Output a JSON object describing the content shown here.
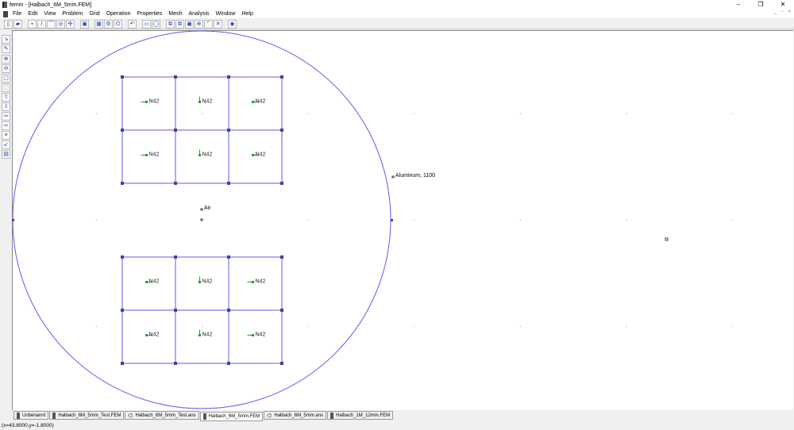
{
  "window": {
    "title": "femm - [Halbach_6M_5mm.FEM]",
    "controls": [
      "–",
      "❐",
      "✕"
    ],
    "mdi_controls": [
      "_",
      "▫",
      "×"
    ]
  },
  "menu": [
    "File",
    "Edit",
    "View",
    "Problem",
    "Grid",
    "Operation",
    "Properties",
    "Mesh",
    "Analysis",
    "Window",
    "Help"
  ],
  "toolbar": [
    {
      "icon": "new-file-icon",
      "g": "▯"
    },
    {
      "icon": "open-file-icon",
      "g": "▰"
    },
    {
      "sep": true
    },
    {
      "icon": "node-mode-icon",
      "g": "▪"
    },
    {
      "icon": "segment-mode-icon",
      "g": "/"
    },
    {
      "icon": "arc-mode-icon",
      "g": "⌒"
    },
    {
      "icon": "block-mode-icon",
      "g": "◎"
    },
    {
      "icon": "group-mode-icon",
      "g": "✣"
    },
    {
      "sep": true
    },
    {
      "icon": "properties-icon",
      "g": "▣"
    },
    {
      "sep": true
    },
    {
      "icon": "mesh-icon",
      "g": "▦"
    },
    {
      "icon": "run-analysis-icon",
      "g": "⚙"
    },
    {
      "icon": "view-results-icon",
      "g": "⌬"
    },
    {
      "sep": true
    },
    {
      "icon": "undo-icon",
      "g": "↶"
    },
    {
      "sep": true
    },
    {
      "icon": "select-box-icon",
      "g": "▭"
    },
    {
      "icon": "select-circle-icon",
      "g": "◯"
    },
    {
      "sep": true
    },
    {
      "icon": "copy-icon",
      "g": "⧉"
    },
    {
      "icon": "move-icon",
      "g": "⧉"
    },
    {
      "icon": "scale-icon",
      "g": "▣"
    },
    {
      "icon": "mirror-icon",
      "g": "⊕"
    },
    {
      "icon": "fillet-icon",
      "g": "⌜"
    },
    {
      "icon": "delete-icon",
      "g": "✕"
    },
    {
      "sep": true
    },
    {
      "icon": "settings-icon",
      "g": "◉"
    }
  ],
  "left_toolbar": [
    {
      "icon": "zoom-natural-icon",
      "g": "↘"
    },
    {
      "icon": "pan-icon",
      "g": "✎"
    },
    {
      "sep": true
    },
    {
      "icon": "zoom-in-icon",
      "g": "⊕"
    },
    {
      "icon": "zoom-out-icon",
      "g": "⊖"
    },
    {
      "icon": "zoom-window-icon",
      "g": "▢"
    },
    {
      "icon": "zoom-fit-icon",
      "g": "⬚"
    },
    {
      "icon": "pan-up-icon",
      "g": "⇧"
    },
    {
      "icon": "pan-down-icon",
      "g": "⇩"
    },
    {
      "icon": "pan-left-icon",
      "g": "⇦"
    },
    {
      "icon": "pan-right-icon",
      "g": "⇨"
    },
    {
      "icon": "grid-show-icon",
      "g": "≡"
    },
    {
      "icon": "snap-grid-icon",
      "g": "↙"
    },
    {
      "icon": "grid-settings-icon",
      "g": "▤"
    }
  ],
  "model": {
    "boundary_color": "#5b5bf0",
    "magnet_color": "#2e9a2e",
    "magnet_material": "N42",
    "magnets_top": [
      "left",
      "up",
      "right",
      "left",
      "up",
      "right"
    ],
    "magnets_bottom": [
      "right",
      "up",
      "left",
      "right",
      "up",
      "left"
    ],
    "air_label": "Air",
    "outer_label": "Aluminum, 1100"
  },
  "tabs": [
    {
      "label": "Unbenannt",
      "type": "fem"
    },
    {
      "label": "Halbach_6M_5mm_Test.FEM",
      "type": "fem"
    },
    {
      "label": "Halbach_6M_5mm_Test.ans",
      "type": "ans"
    },
    {
      "label": "Halbach_6M_5mm.FEM",
      "type": "fem",
      "active": true
    },
    {
      "label": "Halbach_6M_5mm.ans",
      "type": "ans"
    },
    {
      "label": "Halbach_1M_12mm.FEM",
      "type": "fem"
    }
  ],
  "status": "(x=43.8000,y=-1.8000)"
}
